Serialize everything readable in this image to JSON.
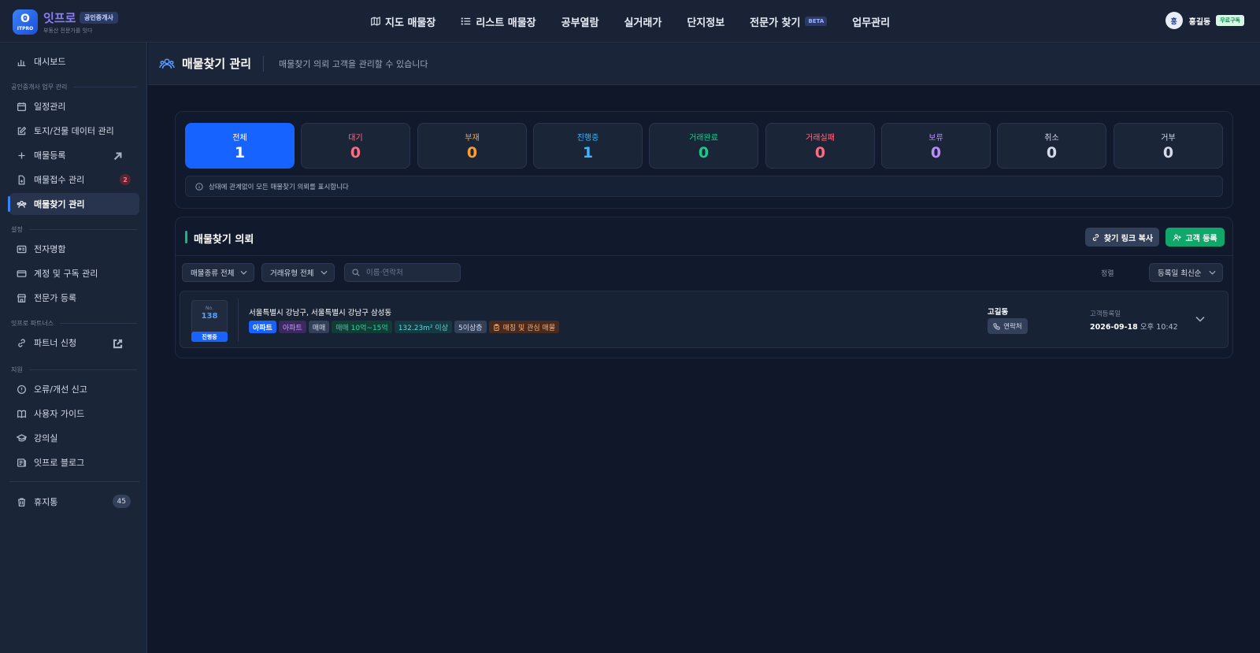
{
  "brand": {
    "logo_glyph": "ʘ",
    "logo_small": "ITPRO",
    "name": "잇프로",
    "badge": "공인중개사",
    "tagline": "부동산 전문가를 잇다"
  },
  "nav": [
    {
      "label": "지도 매물장",
      "icon": "map-icon"
    },
    {
      "label": "리스트 매물장",
      "icon": "list-icon"
    },
    {
      "label": "공부열람"
    },
    {
      "label": "실거래가"
    },
    {
      "label": "단지정보"
    },
    {
      "label": "전문가 찾기",
      "badge": "BETA"
    },
    {
      "label": "업무관리"
    }
  ],
  "user": {
    "avatar": "홍",
    "name": "홍길동",
    "plan": "무료구독"
  },
  "sidebar": {
    "dashboard": "대시보드",
    "section_work": "공인중개사 업무 관리",
    "schedule": "일정관리",
    "land_data": "토지/건물 데이터 관리",
    "listing_register": "매물등록",
    "listing_intake": "매물접수 관리",
    "listing_intake_badge": "2",
    "listing_search": "매물찾기 관리",
    "section_settings": "설정",
    "business_card": "전자명함",
    "account": "계정 및 구독 관리",
    "expert_register": "전문가 등록",
    "section_partners": "잇프로 파트너스",
    "partner_apply": "파트너 신청",
    "section_support": "지원",
    "report": "오류/개선 신고",
    "guide": "사용자 가이드",
    "classroom": "강의실",
    "blog": "잇프로 블로그",
    "trash": "휴지통",
    "trash_count": "45"
  },
  "page": {
    "title": "매물찾기 관리",
    "description": "매물찾기 의뢰 고객을 관리할 수 있습니다"
  },
  "stats": [
    {
      "label": "전체",
      "value": "1",
      "color": "#ffffff",
      "active": true
    },
    {
      "label": "대기",
      "value": "0",
      "color": "#ff6b81"
    },
    {
      "label": "부재",
      "value": "0",
      "color": "#ff9f2e"
    },
    {
      "label": "진행중",
      "value": "1",
      "color": "#3fb6ff"
    },
    {
      "label": "거래완료",
      "value": "0",
      "color": "#19c98b"
    },
    {
      "label": "거래실패",
      "value": "0",
      "color": "#ff6b81"
    },
    {
      "label": "보류",
      "value": "0",
      "color": "#b98cff"
    },
    {
      "label": "취소",
      "value": "0",
      "color": "#d5dbe8"
    },
    {
      "label": "거부",
      "value": "0",
      "color": "#d5dbe8"
    }
  ],
  "stats_note": "상태에 관계없이 모든 매물찾기 의뢰를 표시합니다",
  "requests": {
    "title": "매물찾기 의뢰",
    "copy_link": "찾기 링크 복사",
    "add_customer": "고객 등록",
    "filter_type": "매물종류 전체",
    "filter_deal": "거래유형 전체",
    "search_placeholder": "이름·연락처",
    "sort_label": "정렬",
    "sort_value": "등록일 최신순",
    "items": [
      {
        "no_label": "No.",
        "no": "138",
        "status": "진행중",
        "address": "서울특별시 강남구, 서울특별시 강남구 삼성동",
        "tags": [
          {
            "text": "아파트",
            "bg": "#1763ff",
            "fg": "#ffffff"
          },
          {
            "text": "아파트",
            "bg": "#3b2a5e",
            "fg": "#c79bff"
          },
          {
            "text": "매매",
            "bg": "#33405a",
            "fg": "#d5dbe8"
          },
          {
            "text": "매매 10억~15억",
            "bg": "#123d36",
            "fg": "#2fd39b"
          },
          {
            "text": "132.23m² 이상",
            "bg": "#153a43",
            "fg": "#5fd6d8"
          },
          {
            "text": "5이상층",
            "bg": "#33405a",
            "fg": "#d5dbe8"
          },
          {
            "text": "매칭 및 관심 매물",
            "bg": "#4a2a1c",
            "fg": "#ffae6b",
            "icon": "clipboard-icon"
          }
        ],
        "customer": "고길동",
        "contact": "연락처",
        "reg_label": "고객등록일",
        "reg_date": "2026-09-18",
        "reg_time": "오후 10:42"
      }
    ]
  }
}
